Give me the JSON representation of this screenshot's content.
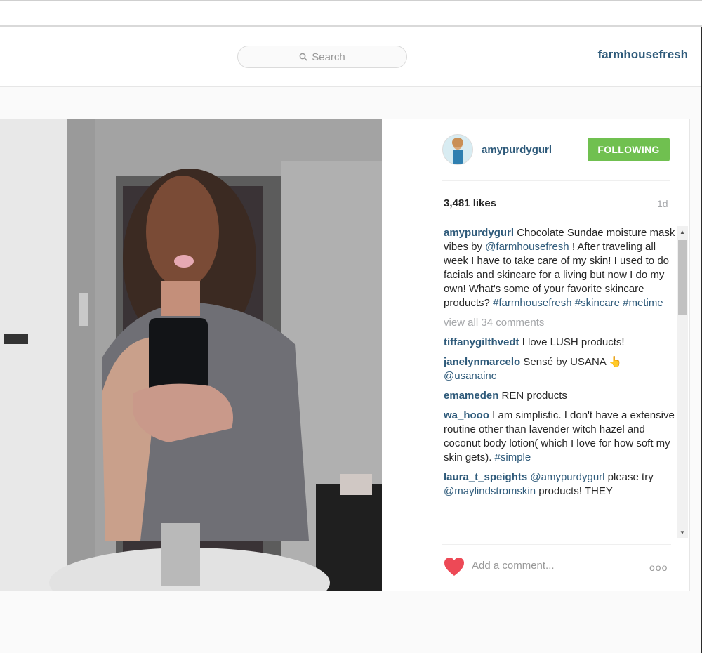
{
  "header": {
    "search_placeholder": "Search",
    "username": "farmhousefresh"
  },
  "post": {
    "owner": "amypurdygurl",
    "follow_label": "FOLLOWING",
    "likes": "3,481 likes",
    "age": "1d",
    "caption": {
      "user": "amypurdygurl",
      "text_1": " Chocolate Sundae moisture mask vibes by ",
      "mention": "@farmhousefresh",
      "text_2": " ! After traveling all week I have to take care of my skin! I used to do facials and skincare for a living but now I do my own! What's some of your favorite skincare products? ",
      "hashtags": "#farmhousefresh #skincare #metime"
    },
    "view_all": "view all 34 comments",
    "comments": [
      {
        "user": "tiffanygilthvedt",
        "text": " I love LUSH products!"
      },
      {
        "user": "janelynmarcelo",
        "text": " Sensé by USANA 👆 ",
        "mention": "@usanainc"
      },
      {
        "user": "emameden",
        "text": " REN products"
      },
      {
        "user": "wa_hooo",
        "text": " I am simplistic. I don't have a extensive routine other than lavender witch hazel and coconut body lotion( which I love for how soft my skin gets). ",
        "tag": "#simple"
      },
      {
        "user": "laura_t_speights",
        "mention": "@amypurdygurl",
        "text": " please try ",
        "mention2": "@maylindstromskin",
        "text2": " products! THEY"
      }
    ],
    "add_comment_placeholder": "Add a comment...",
    "more_label": "ooo"
  },
  "colors": {
    "link": "#2e5a7a",
    "follow_button": "#70c050",
    "like_heart": "#ed4956"
  },
  "icons": [
    "search-icon",
    "heart-icon",
    "more-options-icon",
    "scroll-up-icon",
    "scroll-down-icon"
  ]
}
